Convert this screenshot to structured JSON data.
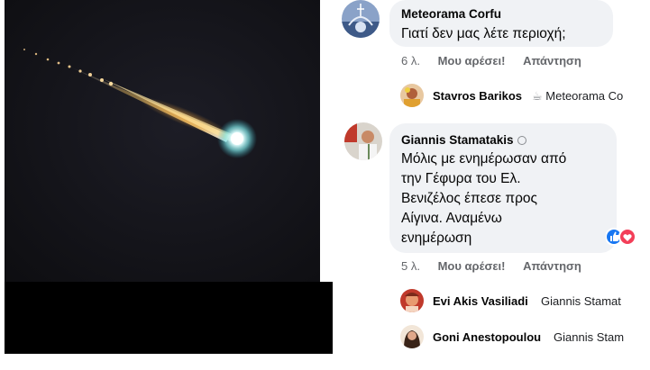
{
  "photo": {
    "subject": "meteor-photo"
  },
  "comments": [
    {
      "author": "Meteorama Corfu",
      "text": "Γιατί δεν μας λέτε περιοχή;",
      "time": "6 λ.",
      "like": "Μου αρέσει!",
      "reply": "Απάντηση"
    },
    {
      "author": "Giannis Stamatakis",
      "text_lines": [
        "Μόλις με ενημέρωσαν από",
        "την Γέφυρα του Ελ.",
        "Βενιζέλος έπεσε  προς",
        "Αίγινα. Αναμένω",
        "ενημέρωση"
      ],
      "time": "5 λ.",
      "like": "Μου αρέσει!",
      "reply": "Απάντηση"
    }
  ],
  "replies": [
    {
      "author": "Stavros Barikos",
      "preview": "Meteorama Co"
    },
    {
      "author": "Evi Akis Vasiliadi",
      "preview": "Giannis Stamat"
    },
    {
      "author": "Goni Anestopoulou",
      "preview": "Giannis Stam"
    }
  ],
  "colors": {
    "bubble": "#f0f2f5",
    "meta_text": "#65676b",
    "like_blue": "#1877f2",
    "heart_red": "#f33e58"
  }
}
